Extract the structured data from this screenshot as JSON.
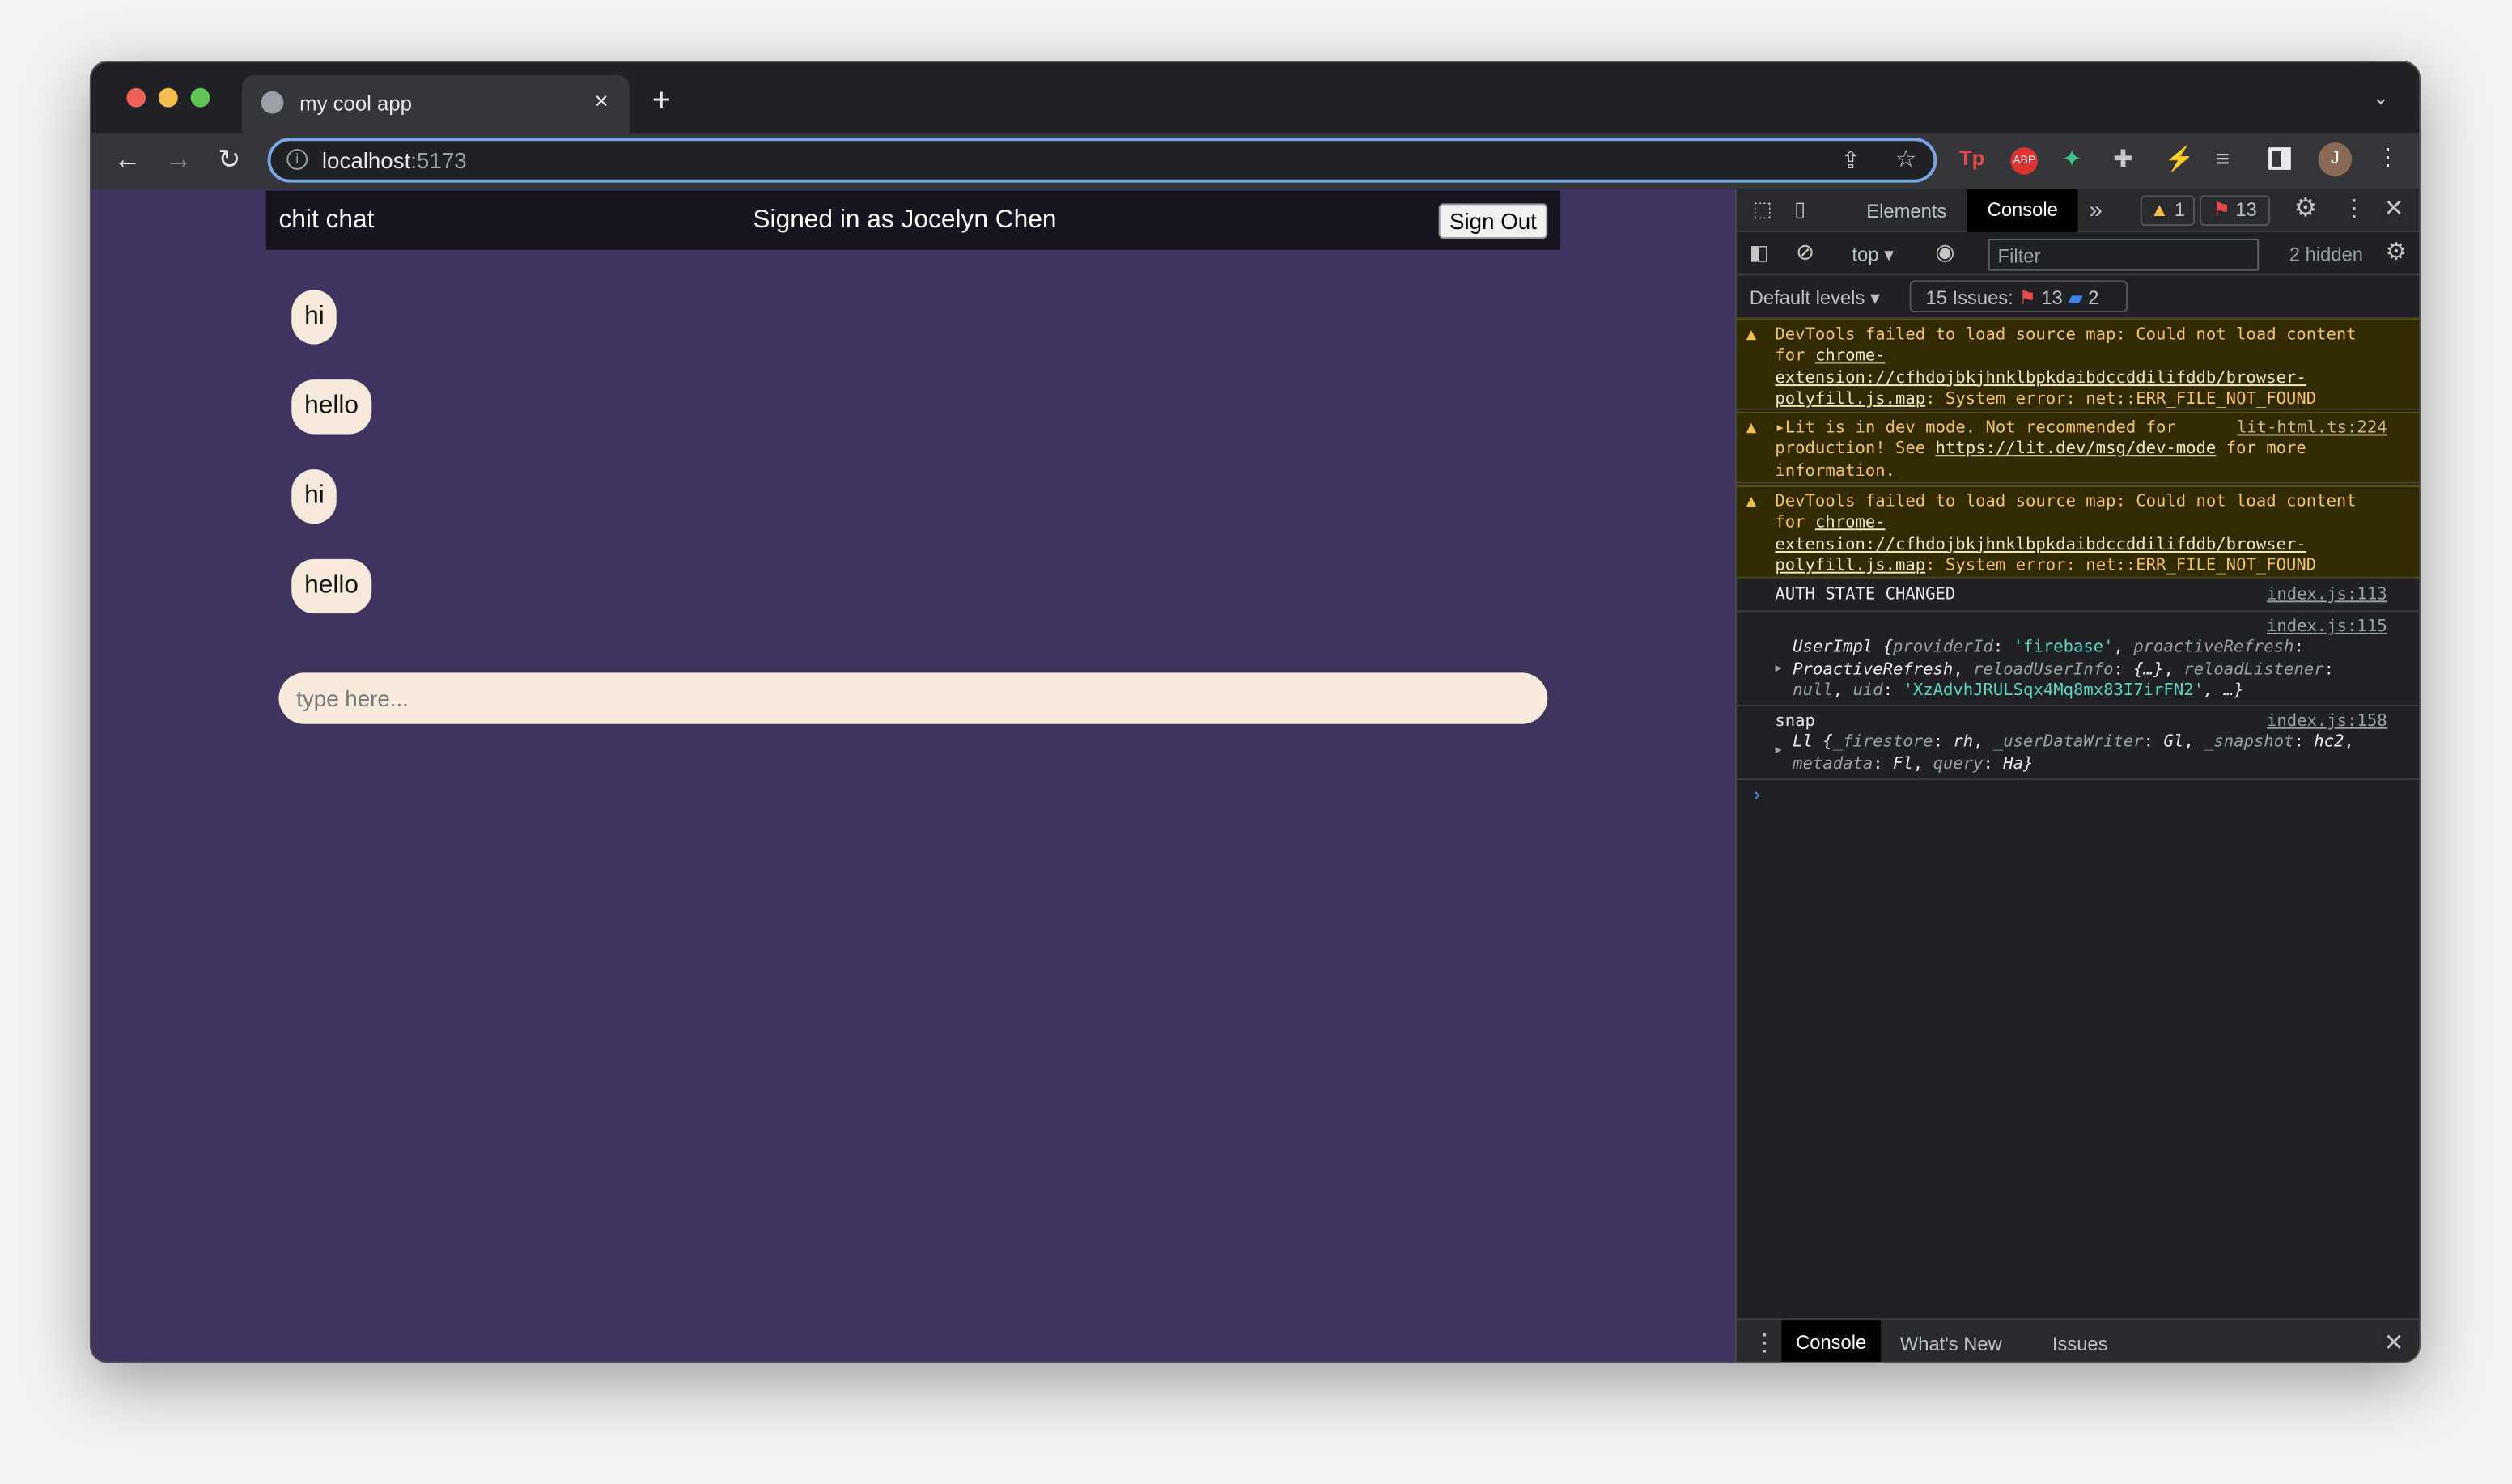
{
  "browser": {
    "tab_title": "my cool app",
    "url_host": "localhost",
    "url_port": ":5173",
    "avatar_initial": "J"
  },
  "app": {
    "title": "chit chat",
    "signed_in": "Signed in as Jocelyn Chen",
    "sign_out": "Sign Out",
    "messages": [
      "hi",
      "hello",
      "hi",
      "hello"
    ],
    "input_placeholder": "type here..."
  },
  "devtools": {
    "tabs": [
      "Elements",
      "Console"
    ],
    "warn_count": "1",
    "error_count": "13",
    "context": "top",
    "filter_placeholder": "Filter",
    "hidden": "2 hidden",
    "levels": "Default levels",
    "issues_label": "15 Issues:",
    "issues_errors": "13",
    "issues_info": "2",
    "console": {
      "w1_a": "DevTools failed to load source map: Could not load content for ",
      "w1_link": "chrome-extension://cfhdojbkjhnklbpkdaibdccddilifddb/browser-polyfill.js.map",
      "w1_b": ": System error: net::ERR_FILE_NOT_FOUND",
      "w2_src": "lit-html.ts:224",
      "w2_a": "Lit is in dev mode. Not recommended for production! See ",
      "w2_link": "https://lit.dev/msg/dev-mode",
      "w2_b": " for more information.",
      "l1": "AUTH STATE CHANGED",
      "l1_src": "index.js:113",
      "l2_src": "index.js:115",
      "l2_obj": {
        "name": "UserImpl {",
        "k1": "providerId",
        "v1": "'firebase'",
        "k2": "proactiveRefresh",
        "v2": "ProactiveRefresh",
        "k3": "reloadUserInfo",
        "v3": "{…}",
        "k4": "reloadListener",
        "v4": "null",
        "k5": "uid",
        "v5": "'XzAdvhJRULSqx4Mq8mx83I7irFN2'",
        "end": ", …}"
      },
      "l3": "snap",
      "l3_src": "index.js:158",
      "l3_obj": {
        "name": "Ll {",
        "k1": "_firestore",
        "v1": "rh",
        "k2": "_userDataWriter",
        "v2": "Gl",
        "k3": "_snapshot",
        "v3": "hc2",
        "k4": "metadata",
        "v4": "Fl",
        "k5": "query",
        "v5": "Ha}"
      }
    },
    "drawer_tabs": [
      "Console",
      "What's New",
      "Issues"
    ]
  },
  "colors": {
    "page_bg": "#3f3360",
    "header_bg": "#17141f",
    "bubble": "#f7eadb",
    "warning_bg": "#332b00"
  }
}
